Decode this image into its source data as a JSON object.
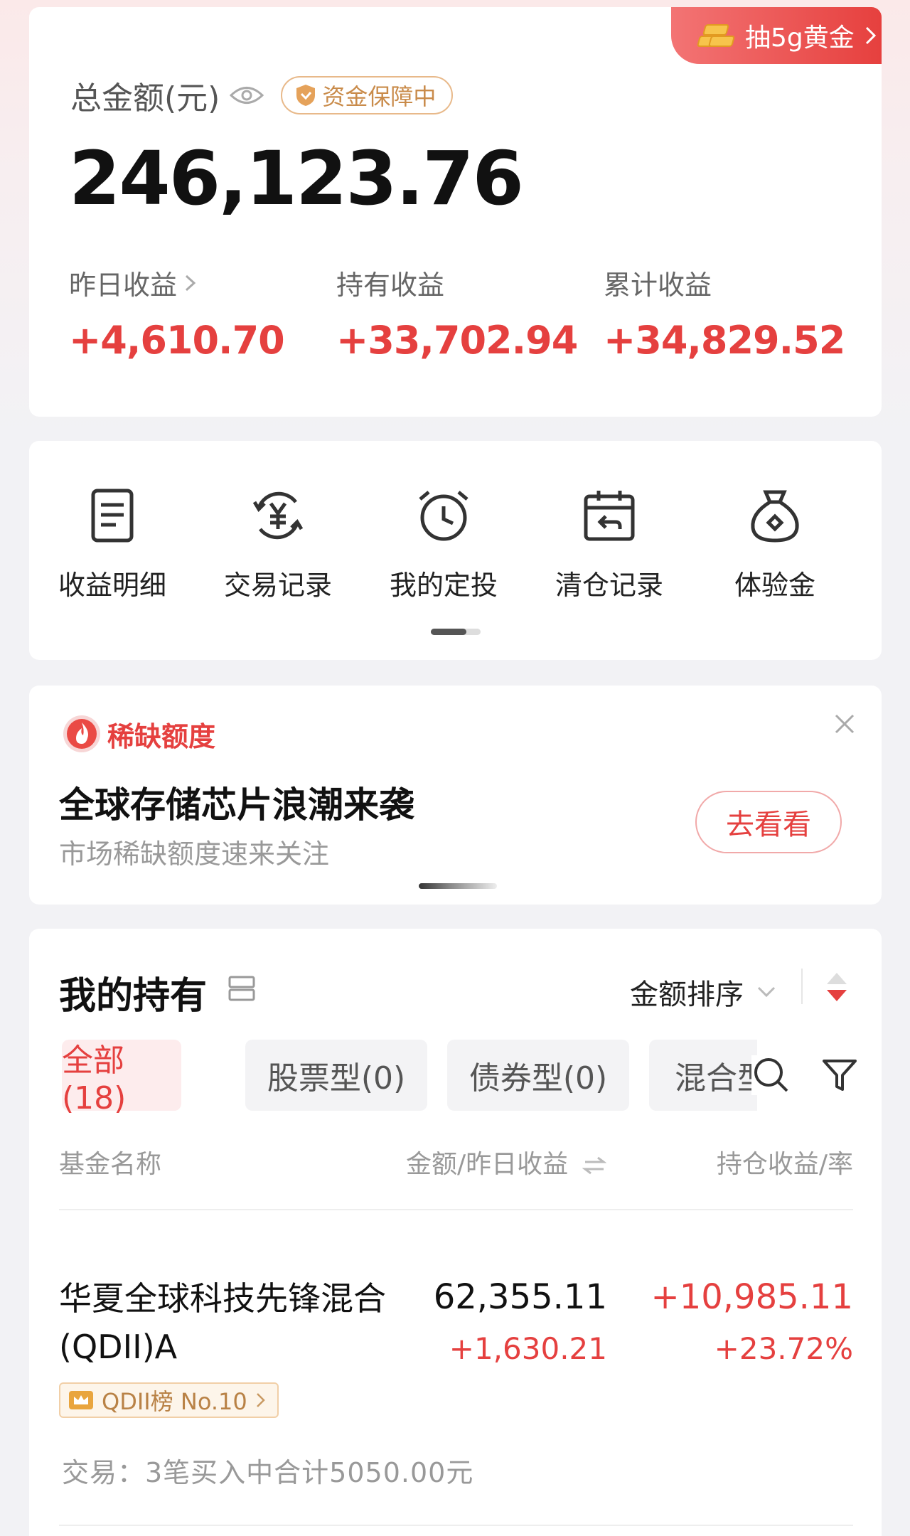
{
  "summary": {
    "promo": "抽5g黄金",
    "total_label": "总金额(元)",
    "guard_badge": "资金保障中",
    "total_value": "246,123.76",
    "stats": [
      {
        "label": "昨日收益",
        "value": "+4,610.70"
      },
      {
        "label": "持有收益",
        "value": "+33,702.94"
      },
      {
        "label": "累计收益",
        "value": "+34,829.52"
      }
    ]
  },
  "actions": [
    {
      "label": "收益明细",
      "icon": "document-icon"
    },
    {
      "label": "交易记录",
      "icon": "yuan-cycle-icon"
    },
    {
      "label": "我的定投",
      "icon": "alarm-clock-icon"
    },
    {
      "label": "清仓记录",
      "icon": "calendar-return-icon"
    },
    {
      "label": "体验金",
      "icon": "money-bag-icon"
    }
  ],
  "banner": {
    "tag": "稀缺额度",
    "title": "全球存储芯片浪潮来袭",
    "subtitle": "市场稀缺额度速来关注",
    "button": "去看看"
  },
  "holdings": {
    "title": "我的持有",
    "sort": "金额排序",
    "chips": [
      "全部(18)",
      "股票型(0)",
      "债券型(0)",
      "混合型"
    ],
    "columns": [
      "基金名称",
      "金额/昨日收益",
      "持仓收益/率"
    ],
    "funds": [
      {
        "name": "华夏全球科技先锋混合(QDII)A",
        "amount": "62,355.11",
        "yesterday": "+1,630.21",
        "profit": "+10,985.11",
        "rate": "+23.72%",
        "rank": "QDII榜 No.10",
        "trade": "交易：3笔买入中合计5050.00元"
      }
    ]
  },
  "colors": {
    "accent_red": "#e5403f",
    "gold_text": "#c98b4a",
    "page_bg": "#f2f2f5"
  }
}
